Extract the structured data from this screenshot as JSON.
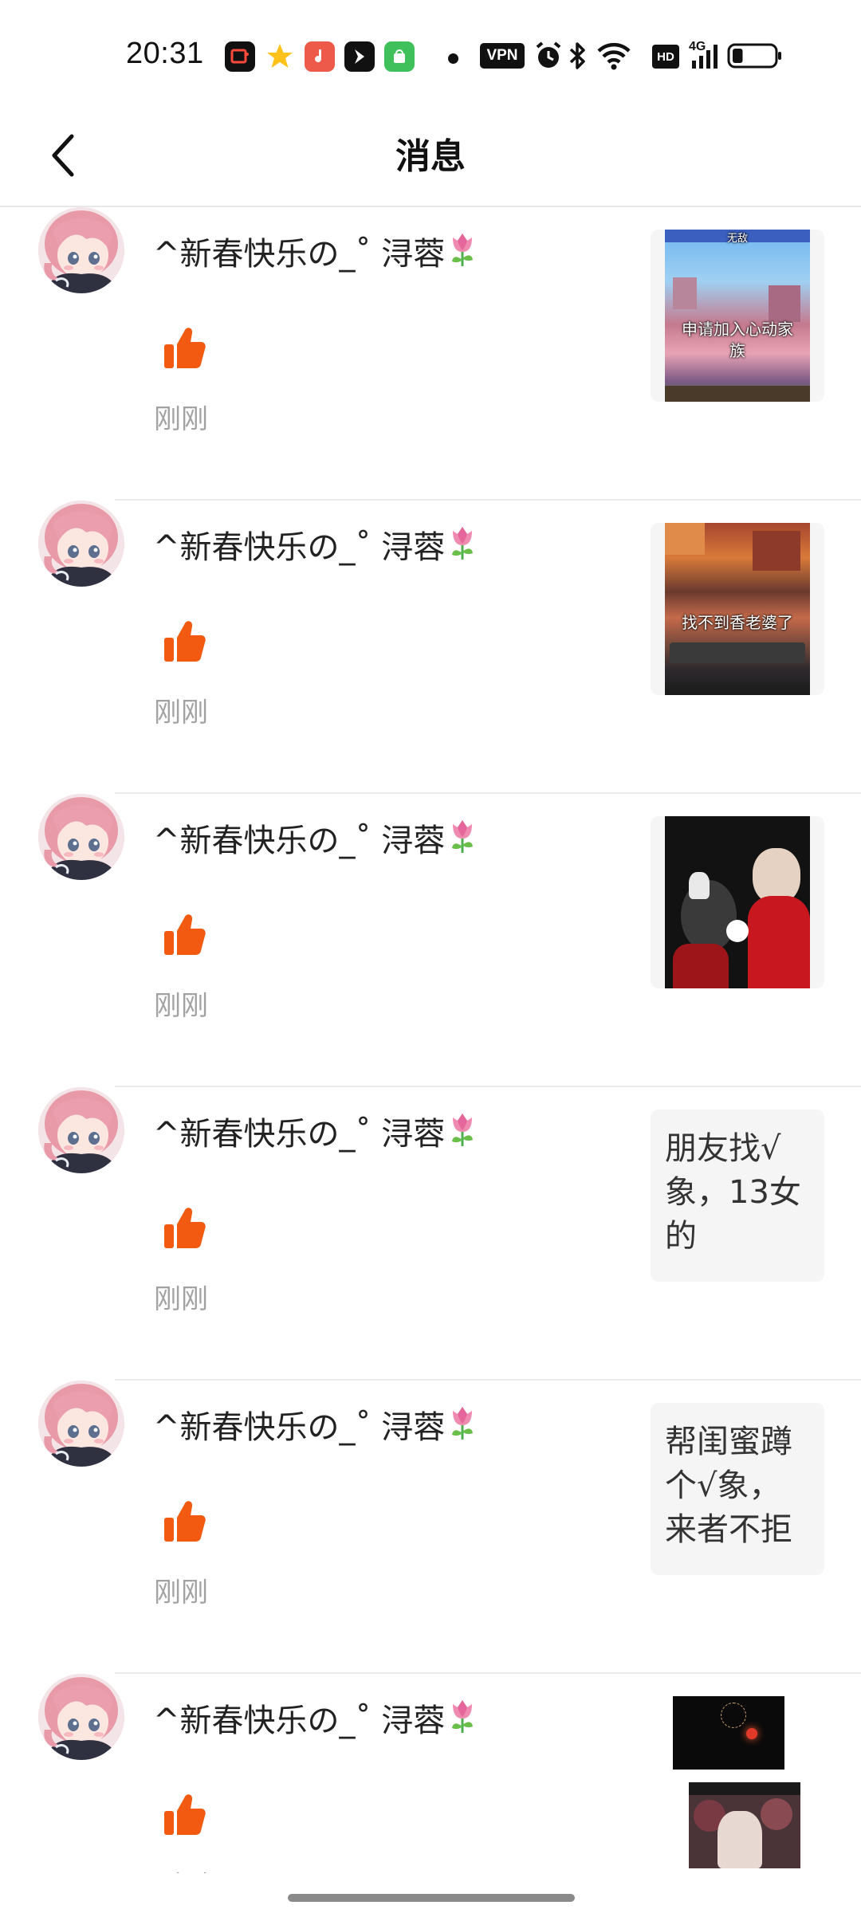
{
  "status_bar": {
    "time": "20:31",
    "vpn": "VPN",
    "hd": "HD",
    "network": "4G",
    "battery_level": 0.25
  },
  "header": {
    "title": "消息"
  },
  "messages": [
    {
      "name": "^新春快乐の_˚ 浔蓉",
      "time": "刚刚",
      "preview": {
        "type": "image",
        "caption": "申请加入心动家族",
        "top_label": "无敌"
      }
    },
    {
      "name": "^新春快乐の_˚ 浔蓉",
      "time": "刚刚",
      "preview": {
        "type": "image",
        "caption": "找不到香老婆了"
      }
    },
    {
      "name": "^新春快乐の_˚ 浔蓉",
      "time": "刚刚",
      "preview": {
        "type": "video"
      }
    },
    {
      "name": "^新春快乐の_˚ 浔蓉",
      "time": "刚刚",
      "preview": {
        "type": "text",
        "text": "朋友找√象，13女的"
      }
    },
    {
      "name": "^新春快乐の_˚ 浔蓉",
      "time": "刚刚",
      "preview": {
        "type": "text",
        "text": "帮闺蜜蹲个√象，来者不拒"
      }
    },
    {
      "name": "^新春快乐の_˚ 浔蓉",
      "time": "刚刚",
      "preview": {
        "type": "image"
      }
    }
  ],
  "icons": {
    "back": "chevron-left-icon",
    "like": "thumbs-up-icon",
    "name_emoji": "tulip-icon"
  },
  "colors": {
    "like": "#f25a12",
    "time_text": "#a2a2a2",
    "divider": "#ececec"
  }
}
